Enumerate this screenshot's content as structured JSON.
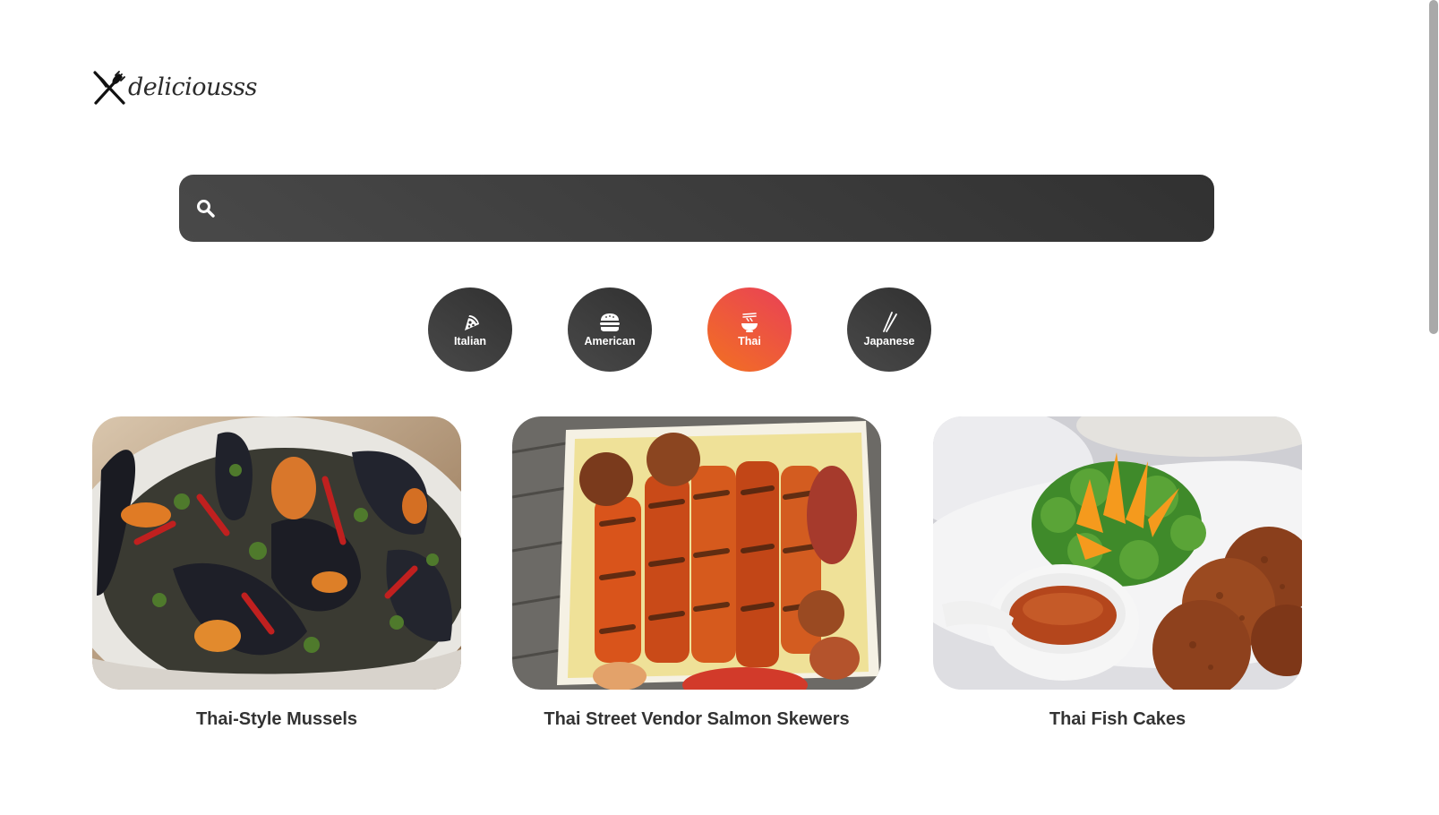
{
  "logo": {
    "text": "deliciousss",
    "icon": "fork-knife-icon"
  },
  "search": {
    "value": "",
    "placeholder": "",
    "icon": "search-icon"
  },
  "categories": [
    {
      "label": "Italian",
      "icon": "pizza-icon",
      "active": false
    },
    {
      "label": "American",
      "icon": "burger-icon",
      "active": false
    },
    {
      "label": "Thai",
      "icon": "noodle-bowl-icon",
      "active": true
    },
    {
      "label": "Japanese",
      "icon": "chopsticks-icon",
      "active": false
    }
  ],
  "recipes": [
    {
      "title": "Thai-Style Mussels"
    },
    {
      "title": "Thai Street Vendor Salmon Skewers"
    },
    {
      "title": "Thai Fish Cakes"
    }
  ],
  "colors": {
    "active_gradient_start": "#f27121",
    "active_gradient_end": "#e94057",
    "dark_gradient_start": "#494949",
    "dark_gradient_end": "#313131",
    "title_text": "#333333"
  },
  "scrollbar": {
    "position_fraction": 0.0,
    "visible_fraction": 0.41
  }
}
